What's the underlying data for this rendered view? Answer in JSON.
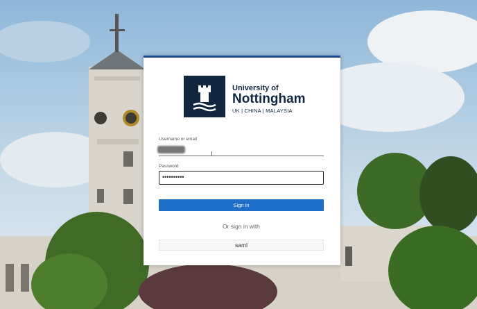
{
  "university": {
    "line1": "University of",
    "line2": "Nottingham",
    "line3": "UK | CHINA | MALAYSIA"
  },
  "form": {
    "username_label": "Username or email",
    "password_label": "Password",
    "password_value": "••••••••••",
    "signin_label": "Sign in",
    "or_text": "Or sign in with",
    "saml_label": "saml"
  },
  "colors": {
    "accent": "#1d6fc9",
    "brand_navy": "#10263f",
    "card_top_border": "#1d4a8f"
  }
}
